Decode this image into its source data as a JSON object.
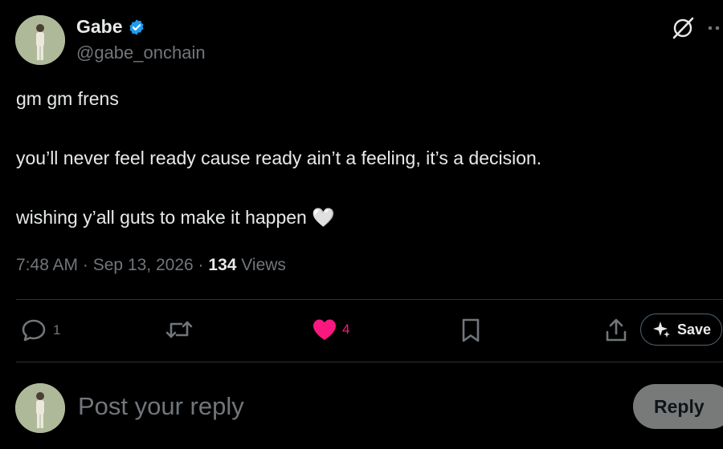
{
  "author": {
    "name": "Gabe",
    "handle": "@gabe_onchain",
    "verified_color": "#1d9bf0",
    "avatar_icon": "person-avatar-icon"
  },
  "tweet": {
    "line1": "gm gm frens",
    "line2": "you’ll never feel ready cause ready ain’t a feeling, it’s a decision.",
    "line3": "wishing y’all guts to make it happen 🤍",
    "time": "7:48 AM",
    "separator": "·",
    "date": "Sep 13, 2026",
    "views_count": "134",
    "views_label": "Views"
  },
  "actions": {
    "reply_count": "1",
    "retweet_count": "",
    "like_count": "4",
    "like_color": "#f91880",
    "save_label": "Save"
  },
  "reply_box": {
    "placeholder": "Post your reply",
    "button_label": "Reply"
  },
  "icons": [
    "grok-icon",
    "more-icon",
    "reply-icon",
    "retweet-icon",
    "heart-icon",
    "bookmark-icon",
    "share-icon",
    "save-sparkle-icon"
  ]
}
